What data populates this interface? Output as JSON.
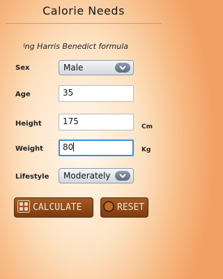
{
  "app": {
    "title": "Calorie Needs"
  },
  "formula_caption": "Using Harris Benedict formula",
  "form": {
    "sex": {
      "label": "Sex",
      "value": "Male"
    },
    "age": {
      "label": "Age",
      "value": "35"
    },
    "height": {
      "label": "Height",
      "value": "175",
      "unit": "Cm"
    },
    "weight": {
      "label": "Weight",
      "value": "80",
      "unit": "Kg"
    },
    "lifestyle": {
      "label": "Lifestyle",
      "value": "Moderately"
    }
  },
  "buttons": {
    "calculate": "CALCULATE",
    "reset": "RESET"
  },
  "icons": {
    "dropdown": "chevron-down-icon",
    "calculate": "calculator-icon",
    "reset": "reset-circle-icon"
  }
}
